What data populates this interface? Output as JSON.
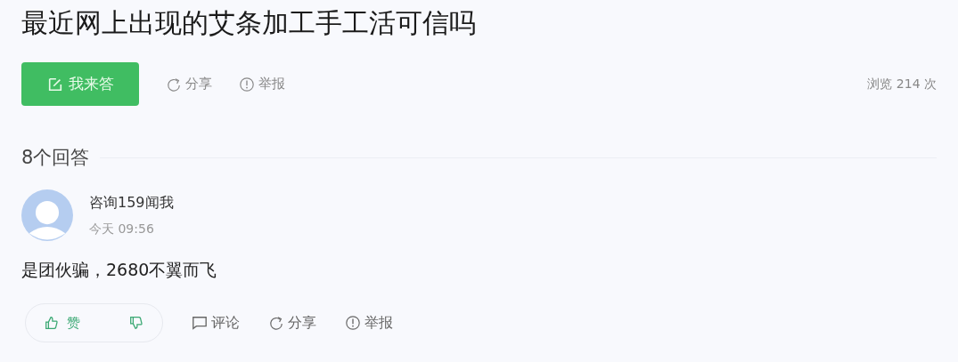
{
  "question": {
    "title": "最近网上出现的艾条加工手工活可信吗"
  },
  "actions": {
    "answer_button": "我来答",
    "share": "分享",
    "report": "举报",
    "views": "浏览 214 次"
  },
  "answers_count": "8个回答",
  "answers": [
    {
      "author": "咨询159闻我",
      "time": "今天 09:56",
      "text": "是团伙骗，2680不翼而飞",
      "like_label": "赞",
      "comment": "评论",
      "share": "分享",
      "report": "举报"
    }
  ]
}
